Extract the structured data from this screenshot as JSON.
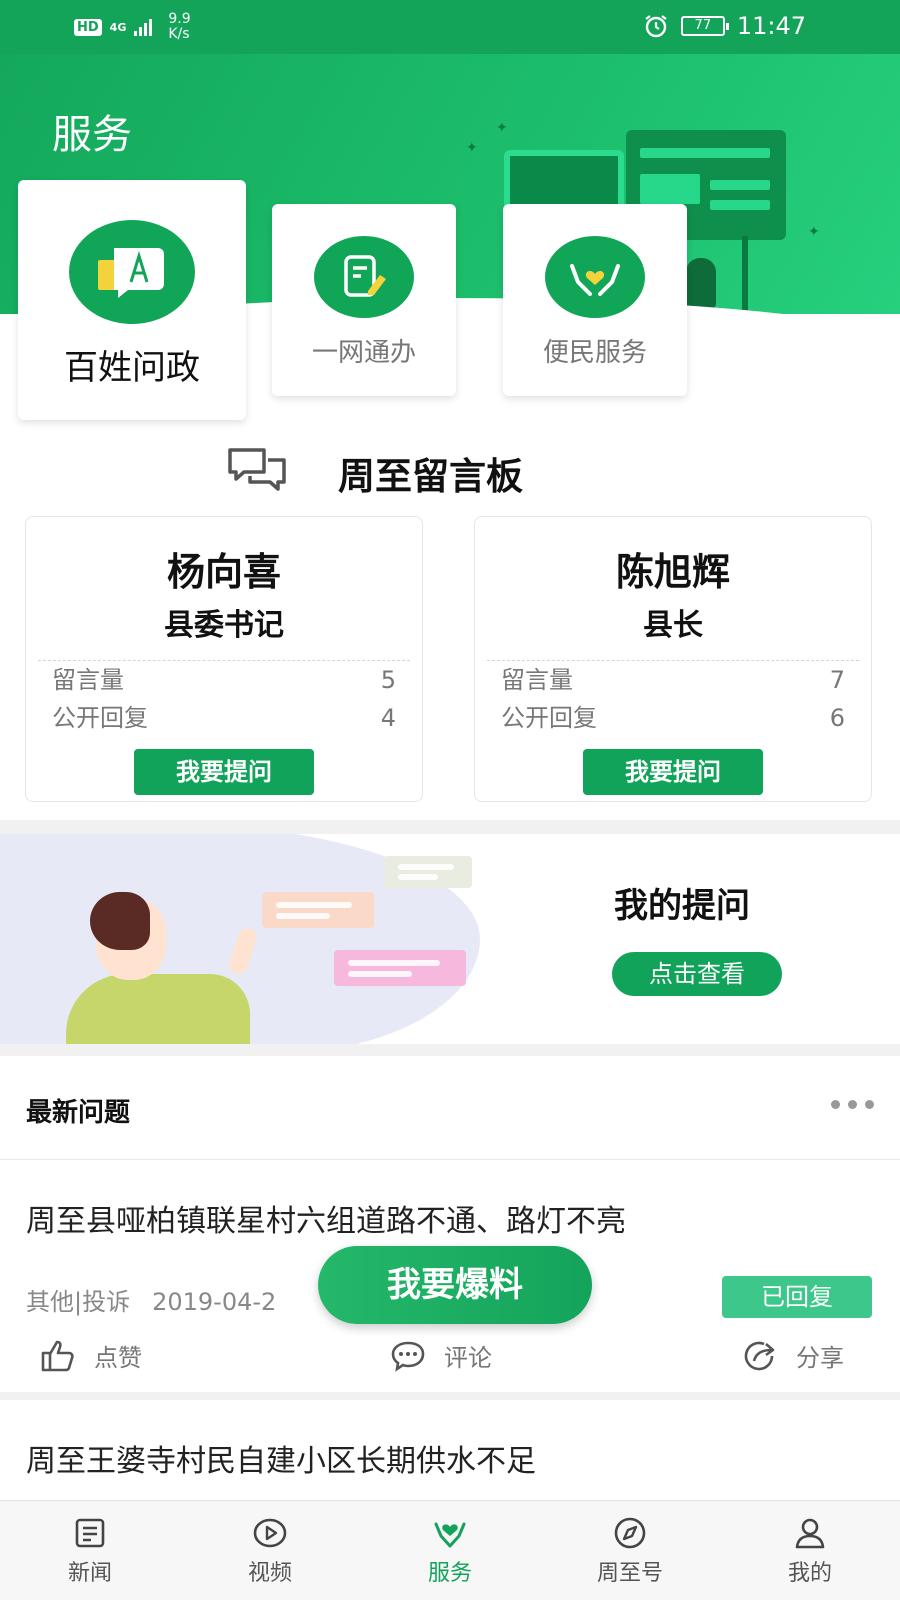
{
  "status_bar": {
    "hd": "HD",
    "network": "4G",
    "speed_value": "9.9",
    "speed_unit": "K/s",
    "battery": "77",
    "time": "11:47"
  },
  "header": {
    "title": "服务"
  },
  "features": [
    {
      "label": "百姓问政",
      "icon": "chat-letter-icon"
    },
    {
      "label": "一网通办",
      "icon": "document-pen-icon"
    },
    {
      "label": "便民服务",
      "icon": "hands-heart-icon"
    }
  ],
  "message_board": {
    "title": "周至留言板",
    "icon": "chat-bubbles-icon",
    "officials": [
      {
        "name": "杨向喜",
        "role": "县委书记",
        "messages_label": "留言量",
        "messages": "5",
        "replies_label": "公开回复",
        "replies": "4",
        "button": "我要提问"
      },
      {
        "name": "陈旭辉",
        "role": "县长",
        "messages_label": "留言量",
        "messages": "7",
        "replies_label": "公开回复",
        "replies": "6",
        "button": "我要提问"
      }
    ]
  },
  "my_questions": {
    "title": "我的提问",
    "button": "点击查看"
  },
  "latest": {
    "title": "最新问题",
    "more_icon": "more-dots-icon",
    "items": [
      {
        "title": "周至县哑柏镇联星村六组道路不通、路灯不亮",
        "category": "其他|投诉",
        "date": "2019-04-2",
        "status": "已回复",
        "actions": {
          "like": "点赞",
          "comment": "评论",
          "share": "分享"
        }
      },
      {
        "title": "周至王婆寺村民自建小区长期供水不足"
      }
    ]
  },
  "fab": {
    "label": "我要爆料"
  },
  "bottom_nav": [
    {
      "label": "新闻",
      "icon": "news-icon",
      "active": false
    },
    {
      "label": "视频",
      "icon": "video-icon",
      "active": false
    },
    {
      "label": "服务",
      "icon": "service-icon",
      "active": true
    },
    {
      "label": "周至号",
      "icon": "compass-icon",
      "active": false
    },
    {
      "label": "我的",
      "icon": "user-icon",
      "active": false
    }
  ],
  "colors": {
    "primary": "#12a35a",
    "header_gradient": "#1cbf6c",
    "status_reply": "#3dc78a"
  }
}
